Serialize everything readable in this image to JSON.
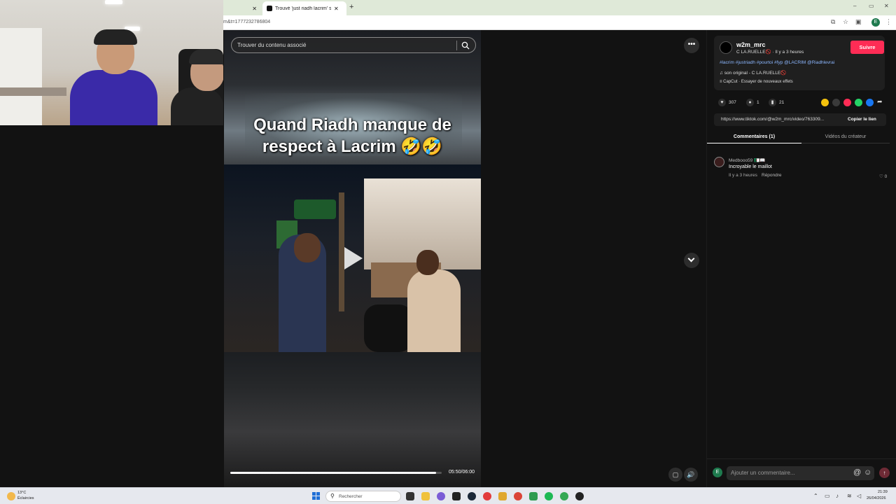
{
  "browser": {
    "tabs": [
      {
        "label": ""
      },
      {
        "label": "Trouvé 'just riadh lacrim' sur TikTok"
      }
    ],
    "new_tab": "+",
    "url": "m&t=1777232786804",
    "window_controls": [
      "–",
      "▭",
      "✕"
    ],
    "profile_initial": "E"
  },
  "video": {
    "search_placeholder": "Trouver du contenu associé",
    "caption_line1": "Quand Riadh manque de",
    "caption_line2": "respect à Lacrim 🤣🤣",
    "timecode": "05:50/06:00",
    "progress": 0.972
  },
  "author": {
    "username": "w2m_mrc",
    "display_name": "C LA.RUELLE🚫",
    "time": "Il y a 3 heures",
    "follow_label": "Suivre",
    "hashtags": "#lacrim #justriadh #pourtoi #fyp @LACRIM @Riadhlevrai",
    "music": "son original - C LA.RUELLE🚫",
    "effect": "CapCut · Essayer de nouveaux effets"
  },
  "stats": {
    "likes": "307",
    "comments": "1",
    "saves": "21"
  },
  "share_colors": [
    "#f4c20d",
    "#3a3a3a",
    "#fe2c55",
    "#25d366",
    "#1877f2"
  ],
  "link": {
    "url": "https://www.tiktok.com/@w2m_mrc/video/763309...",
    "copy_label": "Copier le lien"
  },
  "panel_tabs": {
    "comments": "Commentaires (1)",
    "creator_videos": "Vidéos du créateur"
  },
  "comment": {
    "user": "Medbooo59 🇩🇿📖",
    "text": "Incroyable le maillot",
    "time": "Il y a 3 heures",
    "reply": "Répondre",
    "likes": "0"
  },
  "composer": {
    "avatar_initial": "E",
    "placeholder": "Ajouter un commentaire..."
  },
  "taskbar": {
    "temperature": "13°C",
    "weather": "Éclaircies",
    "search_placeholder": "Rechercher",
    "time": "21:39",
    "date": "26/04/2026"
  }
}
